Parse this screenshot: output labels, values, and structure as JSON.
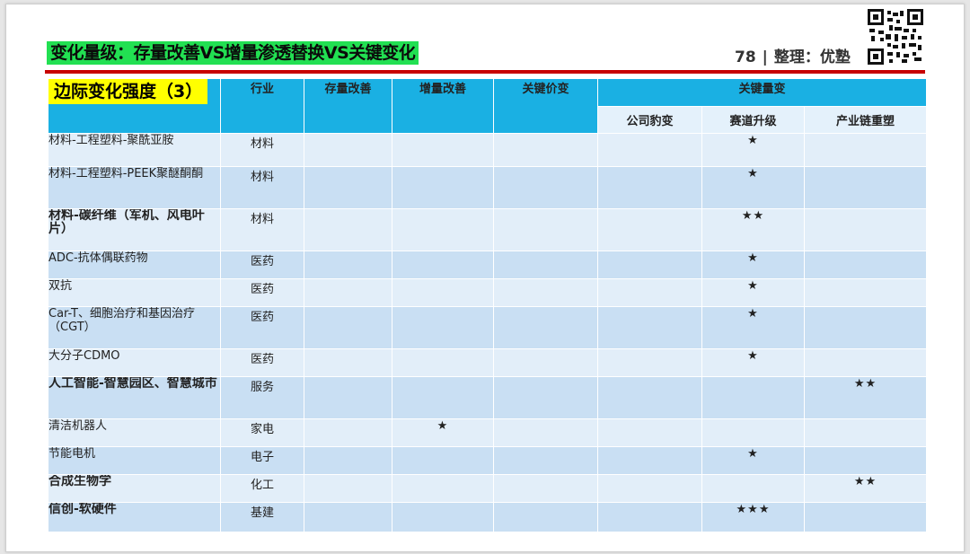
{
  "header": {
    "title": "变化量级：存量改善VS增量渗透替换VS关键变化",
    "page_number": "78",
    "separator": "|",
    "source": "整理：优塾"
  },
  "colors": {
    "title_bg": "#22e052",
    "rule": "#c80000",
    "header_bg": "#1ab0e3",
    "row_light": "#e2eef9",
    "row_dark": "#c9dff3",
    "star": "#e01010",
    "highlight": "#ffff00"
  },
  "table": {
    "title": "边际变化强度（3）",
    "columns": {
      "industry": "行业",
      "stock": "存量改善",
      "increment": "增量改善",
      "key_price": "关键价变",
      "key_quantity": "关键量变"
    },
    "subcolumns": [
      "公司豹变",
      "赛道升级",
      "产业链重塑"
    ],
    "rows": [
      {
        "name": "材料-工程塑料-聚酰亚胺",
        "industry": "材料",
        "stock": "",
        "increment": "",
        "price": "",
        "company": "",
        "track": "★",
        "chain": ""
      },
      {
        "name": "材料-工程塑料-PEEK聚醚酮酮",
        "industry": "材料",
        "stock": "",
        "increment": "",
        "price": "",
        "company": "",
        "track": "★",
        "chain": ""
      },
      {
        "name": "材料-碳纤维（军机、风电叶片）",
        "industry": "材料",
        "stock": "",
        "increment": "",
        "price": "",
        "company": "",
        "track": "★★",
        "chain": ""
      },
      {
        "name": "ADC-抗体偶联药物",
        "industry": "医药",
        "stock": "",
        "increment": "",
        "price": "",
        "company": "",
        "track": "★",
        "chain": ""
      },
      {
        "name": "双抗",
        "industry": "医药",
        "stock": "",
        "increment": "",
        "price": "",
        "company": "",
        "track": "★",
        "chain": ""
      },
      {
        "name": "Car-T、细胞治疗和基因治疗（CGT）",
        "industry": "医药",
        "stock": "",
        "increment": "",
        "price": "",
        "company": "",
        "track": "★",
        "chain": ""
      },
      {
        "name": "大分子CDMO",
        "industry": "医药",
        "stock": "",
        "increment": "",
        "price": "",
        "company": "",
        "track": "★",
        "chain": ""
      },
      {
        "name": "人工智能-智慧园区、智慧城市",
        "industry": "服务",
        "stock": "",
        "increment": "",
        "price": "",
        "company": "",
        "track": "",
        "chain": "★★"
      },
      {
        "name": "清洁机器人",
        "industry": "家电",
        "stock": "",
        "increment": "★",
        "price": "",
        "company": "",
        "track": "",
        "chain": ""
      },
      {
        "name": "节能电机",
        "industry": "电子",
        "stock": "",
        "increment": "",
        "price": "",
        "company": "",
        "track": "★",
        "chain": ""
      },
      {
        "name": "合成生物学",
        "industry": "化工",
        "stock": "",
        "increment": "",
        "price": "",
        "company": "",
        "track": "",
        "chain": "★★"
      },
      {
        "name": "信创-软硬件",
        "industry": "基建",
        "stock": "",
        "increment": "",
        "price": "",
        "company": "",
        "track": "★★★",
        "chain": ""
      }
    ]
  }
}
